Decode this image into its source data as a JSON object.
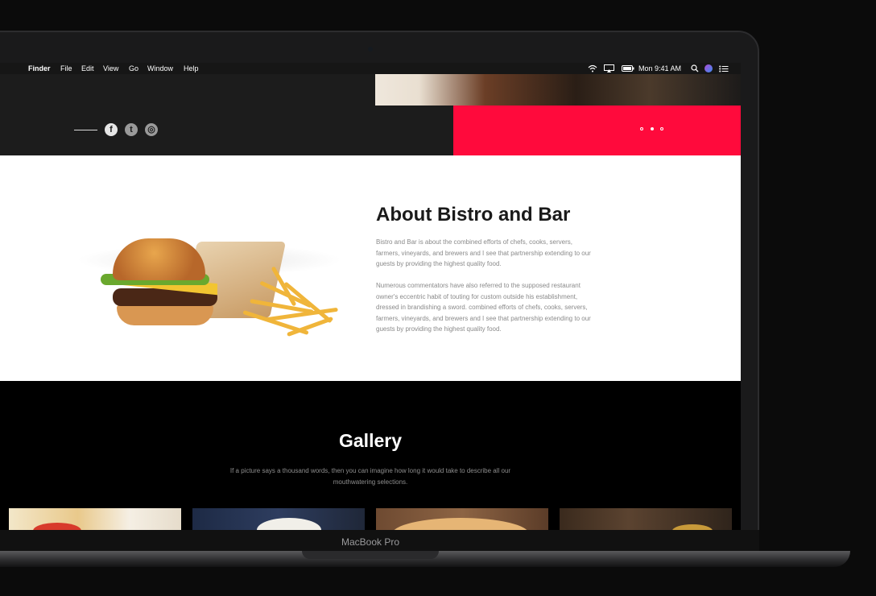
{
  "menubar": {
    "apple": "",
    "app": "Finder",
    "items": [
      "File",
      "Edit",
      "View",
      "Go",
      "Window",
      "Help"
    ],
    "clock": "Mon 9:41 AM"
  },
  "hero": {
    "social": [
      "f",
      "t",
      "◎"
    ],
    "carousel_dots": 3,
    "active_dot": 2,
    "accent": "#ff0a3c"
  },
  "about": {
    "title": "About Bistro and Bar",
    "paragraph1": "Bistro and Bar is about the combined efforts of chefs, cooks, servers, farmers, vineyards, and brewers and I see that partnership extending to our guests by providing the highest quality food.",
    "paragraph2": "Numerous commentators have also referred to the supposed restaurant owner's eccentric habit of touting for custom outside his establishment, dressed in brandishing a sword. combined efforts of chefs, cooks, servers, farmers, vineyards, and brewers and I see that partnership extending to our guests by providing the highest quality food."
  },
  "gallery": {
    "title": "Gallery",
    "subtitle": "If a picture says a thousand words, then you can imagine how long it would take to describe all our mouthwatering selections."
  },
  "device": {
    "label": "MacBook Pro"
  }
}
